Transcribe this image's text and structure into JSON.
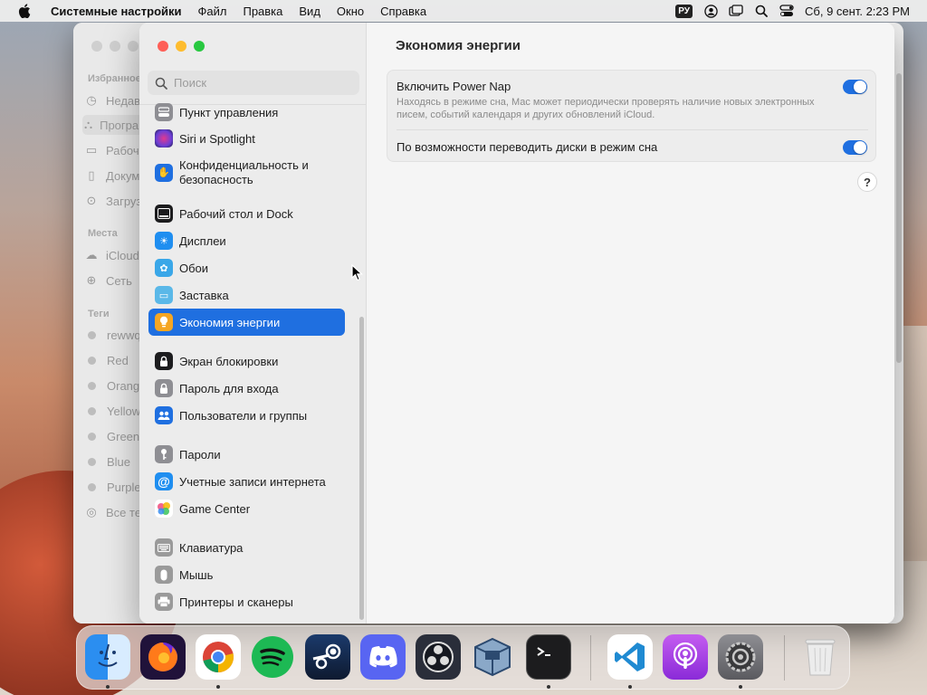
{
  "menubar": {
    "app_name": "Системные настройки",
    "menus": [
      "Файл",
      "Правка",
      "Вид",
      "Окно",
      "Справка"
    ],
    "input_source": "РУ",
    "clock": "Сб, 9 сент.  2:23 PM",
    "icons": [
      "apple-icon",
      "user-icon",
      "screen-mirroring-icon",
      "search-icon",
      "control-center-icon"
    ]
  },
  "finder": {
    "sections": {
      "favorites": "Избранное",
      "locations": "Места",
      "tags": "Теги"
    },
    "favorites": [
      "Недавние",
      "Программы",
      "Рабочий стол",
      "Документы",
      "Загрузки"
    ],
    "locations": [
      "iCloud Drive",
      "Сеть"
    ],
    "tags": [
      "rewwq",
      "Red",
      "Orange",
      "Yellow",
      "Green",
      "Blue",
      "Purple",
      "Все теги…"
    ]
  },
  "sidebar": {
    "search_placeholder": "Поиск",
    "items": [
      {
        "label": "Пункт управления",
        "icon": "control-center-icon",
        "color": "#8e8e93"
      },
      {
        "label": "Siri и Spotlight",
        "icon": "siri-icon",
        "color": "#6b3fd6"
      },
      {
        "label": "Конфиденциальность и безопасность",
        "icon": "hand-icon",
        "color": "#1f6fe0"
      },
      {
        "label": "Рабочий стол и Dock",
        "icon": "dock-icon",
        "color": "#1c1c1e"
      },
      {
        "label": "Дисплеи",
        "icon": "sun-icon",
        "color": "#1f8ef0"
      },
      {
        "label": "Обои",
        "icon": "flower-icon",
        "color": "#3aa7e8"
      },
      {
        "label": "Заставка",
        "icon": "screensaver-icon",
        "color": "#5ab8e8"
      },
      {
        "label": "Экономия энергии",
        "icon": "lightbulb-icon",
        "color": "#f5a623"
      },
      {
        "label": "Экран блокировки",
        "icon": "lock-icon",
        "color": "#1c1c1e"
      },
      {
        "label": "Пароль для входа",
        "icon": "padlock-icon",
        "color": "#8e8e93"
      },
      {
        "label": "Пользователи и группы",
        "icon": "users-icon",
        "color": "#1f6fe0"
      },
      {
        "label": "Пароли",
        "icon": "key-icon",
        "color": "#8e8e93"
      },
      {
        "label": "Учетные записи интернета",
        "icon": "at-icon",
        "color": "#1f8ef0"
      },
      {
        "label": "Game Center",
        "icon": "game-center-icon",
        "color": "#ffffff"
      },
      {
        "label": "Клавиатура",
        "icon": "keyboard-icon",
        "color": "#9a9a9a"
      },
      {
        "label": "Мышь",
        "icon": "mouse-icon",
        "color": "#9a9a9a"
      },
      {
        "label": "Принтеры и сканеры",
        "icon": "printer-icon",
        "color": "#9a9a9a"
      }
    ],
    "active_index": 7
  },
  "main": {
    "title": "Экономия энергии",
    "power_nap_title": "Включить Power Nap",
    "power_nap_desc": "Находясь в режиме сна, Mac может периодически проверять наличие новых электронных писем, событий календаря и других обновлений iCloud.",
    "power_nap_on": true,
    "disk_sleep_title": "По возможности переводить диски в режим сна",
    "disk_sleep_on": true,
    "help_label": "?"
  },
  "dock": {
    "apps": [
      "Finder",
      "Firefox",
      "Chrome",
      "Spotify",
      "Steam",
      "Discord",
      "OBS",
      "VirtualBox",
      "Terminal",
      "VS Code",
      "Podcasts",
      "System Settings",
      "Trash"
    ]
  },
  "colors": {
    "accent": "#1f6fe0",
    "sidebar_bg": "#ececec",
    "main_bg": "#f5f5f5"
  }
}
